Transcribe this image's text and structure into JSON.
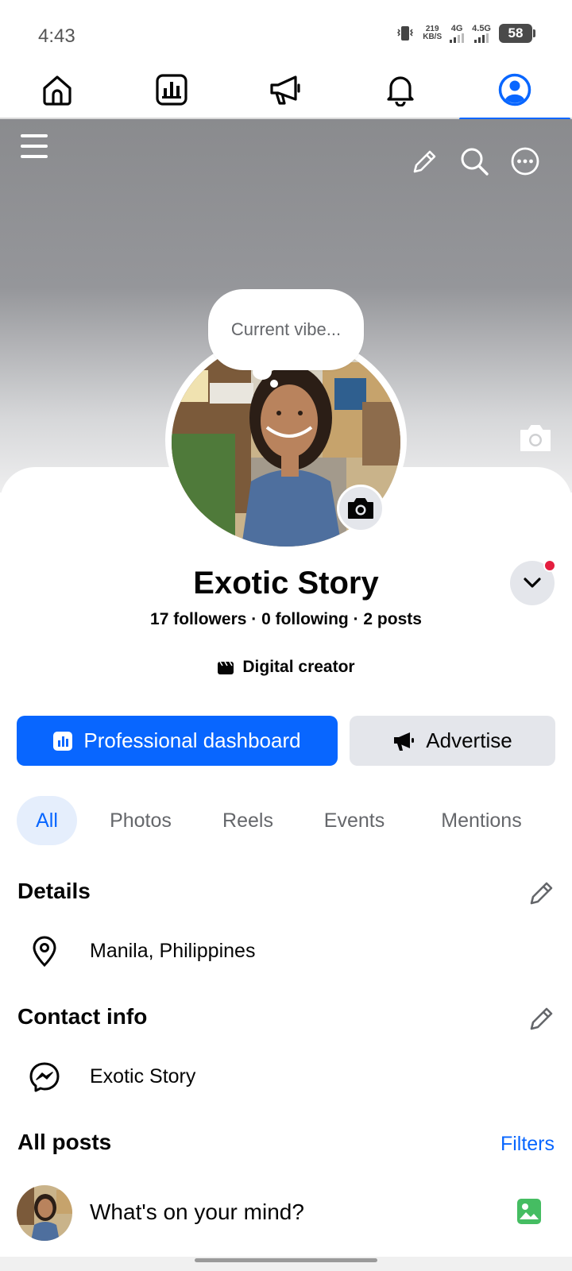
{
  "status_bar": {
    "time": "4:43",
    "net_speed_value": "219",
    "net_speed_unit": "KB/S",
    "sim1_label": "4G",
    "sim2_label": "4.5G",
    "battery": "58"
  },
  "top_nav": {
    "items": [
      "home-icon",
      "dashboard-icon",
      "megaphone-icon",
      "bell-icon",
      "profile-icon"
    ],
    "active_index": 4,
    "accent_color": "#0866ff"
  },
  "profile": {
    "bubble_text": "Current vibe...",
    "name": "Exotic Story",
    "stats": "17 followers · 0 following · 2 posts",
    "category": "Digital creator"
  },
  "actions": {
    "primary_label": "Professional dashboard",
    "secondary_label": "Advertise"
  },
  "tabs": [
    "All",
    "Photos",
    "Reels",
    "Events",
    "Mentions"
  ],
  "details": {
    "title": "Details",
    "location": "Manila, Philippines"
  },
  "contact": {
    "title": "Contact info",
    "messenger": "Exotic Story"
  },
  "posts": {
    "title": "All posts",
    "filters_label": "Filters",
    "composer_placeholder": "What's on your mind?"
  }
}
